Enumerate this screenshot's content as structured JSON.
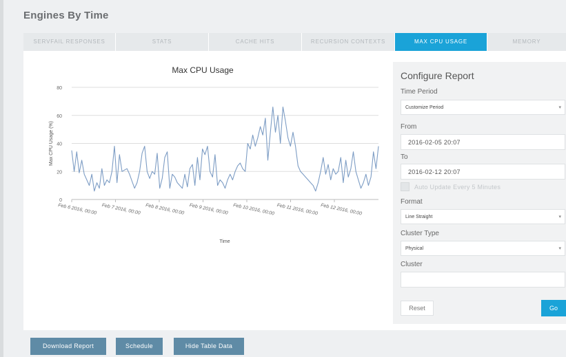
{
  "header": {
    "title": "Engines By Time"
  },
  "tabs": [
    {
      "label": "SERVFAIL RESPONSES",
      "active": false
    },
    {
      "label": "STATS",
      "active": false
    },
    {
      "label": "CACHE HITS",
      "active": false
    },
    {
      "label": "RECURSION CONTEXTS",
      "active": false
    },
    {
      "label": "MAX CPU USAGE",
      "active": true
    },
    {
      "label": "MEMORY",
      "active": false
    }
  ],
  "chart_data": {
    "type": "line",
    "title": "Max CPU Usage",
    "xlabel": "Time",
    "ylabel": "Max CPU Usage (%)",
    "ylim": [
      0,
      80
    ],
    "yticks": [
      "0",
      "20",
      "40",
      "60",
      "80"
    ],
    "xlim": [
      "Feb 6 2016, 00:00",
      "Feb 12 2016, 20:07"
    ],
    "xticks": [
      "Feb 6 2016, 00:00",
      "Feb 7 2016, 00:00",
      "Feb 8 2016, 00:00",
      "Feb 9 2016, 00:00",
      "Feb 10 2016, 00:00",
      "Feb 11 2016, 00:00",
      "Feb 12 2016, 00:00"
    ],
    "grid": true,
    "color": "#7c9cc4",
    "series": [
      {
        "values": [
          35,
          20,
          34,
          19,
          28,
          18,
          14,
          10,
          18,
          6,
          12,
          8,
          22,
          10,
          14,
          12,
          20,
          38,
          12,
          32,
          20,
          21,
          22,
          18,
          13,
          8,
          12,
          20,
          33,
          38,
          20,
          15,
          20,
          18,
          33,
          8,
          15,
          30,
          34,
          8,
          18,
          16,
          12,
          10,
          8,
          18,
          9,
          22,
          25,
          10,
          30,
          14,
          36,
          32,
          38,
          20,
          16,
          32,
          10,
          14,
          12,
          8,
          14,
          18,
          14,
          20,
          24,
          26,
          22,
          20,
          40,
          36,
          46,
          38,
          44,
          52,
          46,
          58,
          28,
          48,
          66,
          48,
          60,
          40,
          66,
          56,
          44,
          38,
          48,
          38,
          24,
          20,
          18,
          16,
          14,
          12,
          10,
          6,
          12,
          20,
          30,
          18,
          25,
          14,
          22,
          18,
          20,
          30,
          12,
          28,
          16,
          22,
          34,
          20,
          14,
          8,
          12,
          18,
          10,
          16,
          34,
          22,
          38
        ]
      }
    ]
  },
  "config": {
    "title": "Configure Report",
    "time_period": {
      "label": "Time Period",
      "value": "Customize Period"
    },
    "from": {
      "label": "From",
      "value": "2016-02-05 20:07"
    },
    "to": {
      "label": "To",
      "value": "2016-02-12 20:07"
    },
    "auto_update": {
      "label": "Auto Update Every 5 Minutes",
      "checked": false
    },
    "format": {
      "label": "Format",
      "value": "Line Straight"
    },
    "cluster_type": {
      "label": "Cluster Type",
      "value": "Physical"
    },
    "cluster": {
      "label": "Cluster",
      "value": ""
    },
    "reset_label": "Reset",
    "go_label": "Go"
  },
  "actions": {
    "download_label": "Download Report",
    "schedule_label": "Schedule",
    "hide_table_label": "Hide Table Data"
  },
  "colors": {
    "accent": "#1aa3d8",
    "button": "#5f8ba6",
    "line": "#7c9cc4"
  }
}
